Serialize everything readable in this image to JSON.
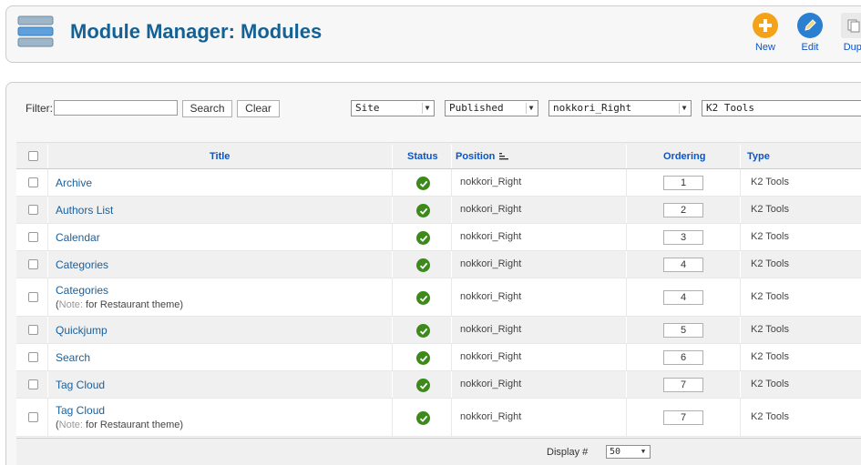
{
  "header": {
    "title": "Module Manager: Modules",
    "icon": "module-manager-icon"
  },
  "toolbar": {
    "new_label": "New",
    "edit_label": "Edit",
    "duplicate_label": "Dupl"
  },
  "filter": {
    "label": "Filter:",
    "value": "",
    "search_label": "Search",
    "clear_label": "Clear",
    "site_value": "Site",
    "state_value": "Published",
    "position_value": "nokkori_Right",
    "type_value": "K2 Tools"
  },
  "table": {
    "headers": {
      "title": "Title",
      "status": "Status",
      "position": "Position",
      "ordering": "Ordering",
      "type": "Type"
    },
    "rows": [
      {
        "title": "Archive",
        "note": null,
        "position": "nokkori_Right",
        "ordering": "1",
        "type": "K2 Tools"
      },
      {
        "title": "Authors List",
        "note": null,
        "position": "nokkori_Right",
        "ordering": "2",
        "type": "K2 Tools"
      },
      {
        "title": "Calendar",
        "note": null,
        "position": "nokkori_Right",
        "ordering": "3",
        "type": "K2 Tools"
      },
      {
        "title": "Categories",
        "note": null,
        "position": "nokkori_Right",
        "ordering": "4",
        "type": "K2 Tools"
      },
      {
        "title": "Categories",
        "note_key": "Note:",
        "note_text": "for Restaurant theme",
        "position": "nokkori_Right",
        "ordering": "4",
        "type": "K2 Tools"
      },
      {
        "title": "Quickjump",
        "note": null,
        "position": "nokkori_Right",
        "ordering": "5",
        "type": "K2 Tools"
      },
      {
        "title": "Search",
        "note": null,
        "position": "nokkori_Right",
        "ordering": "6",
        "type": "K2 Tools"
      },
      {
        "title": "Tag Cloud",
        "note": null,
        "position": "nokkori_Right",
        "ordering": "7",
        "type": "K2 Tools"
      },
      {
        "title": "Tag Cloud",
        "note_key": "Note:",
        "note_text": "for Restaurant theme",
        "position": "nokkori_Right",
        "ordering": "7",
        "type": "K2 Tools"
      }
    ]
  },
  "footer": {
    "display_label": "Display #",
    "display_value": "50"
  },
  "colors": {
    "title": "#146295",
    "link": "#1a5f9a",
    "header_link": "#0b55c4",
    "status_green": "#3c8a1a",
    "new_orange": "#f39c12",
    "edit_blue": "#2a7fd1"
  }
}
